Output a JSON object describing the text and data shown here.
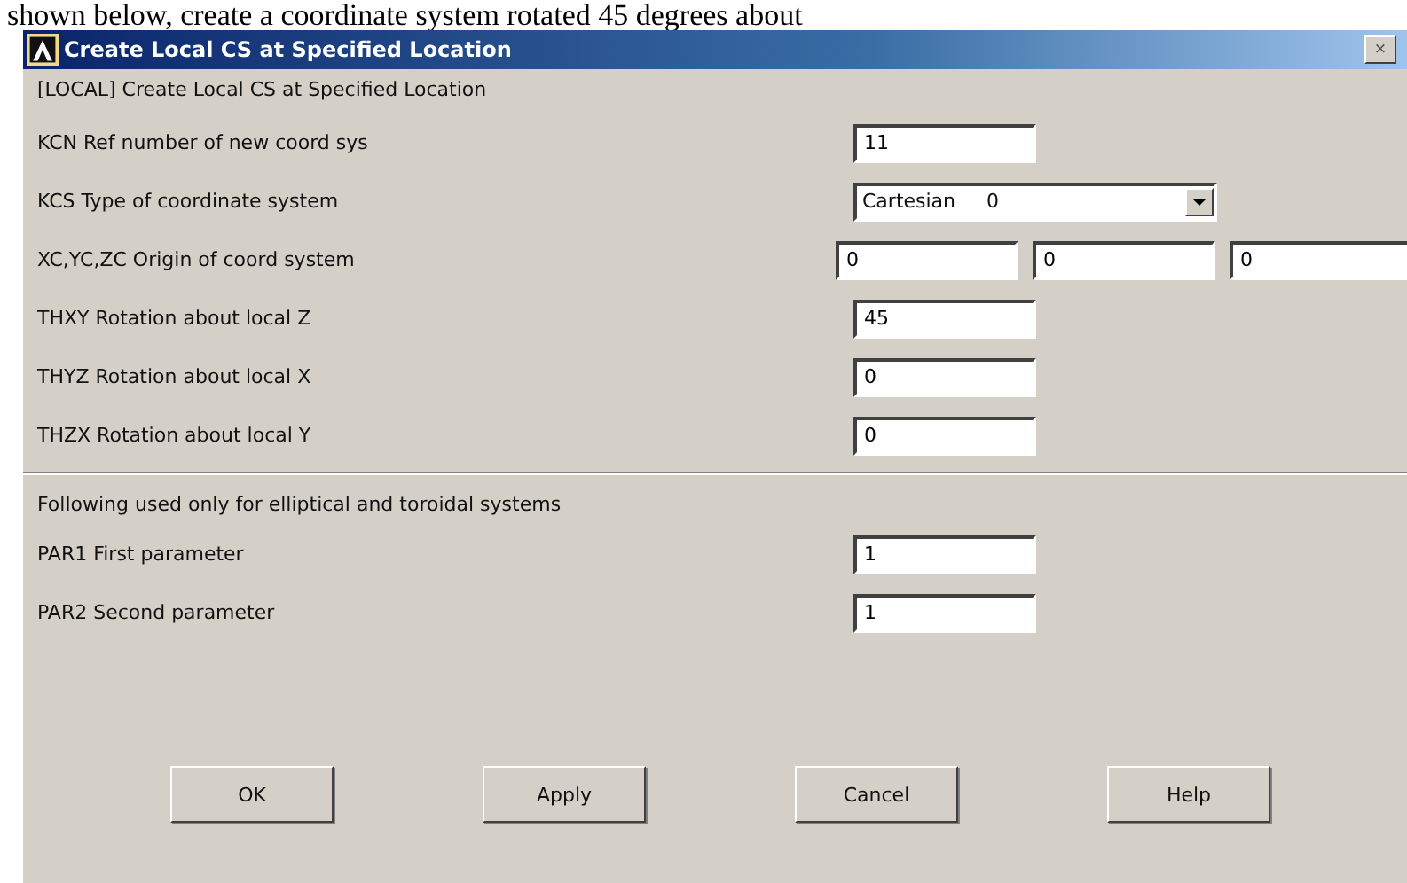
{
  "page_text": "shown below, create a coordinate system rotated 45 degrees about",
  "window": {
    "title": "Create Local CS at Specified Location",
    "close": "×"
  },
  "heading": "[LOCAL]  Create Local CS at Specified Location",
  "fields": [
    {
      "kind": "text",
      "label": "KCN  Ref number of new coord sys",
      "values": [
        "11"
      ]
    },
    {
      "kind": "dropdown",
      "label": "KCS  Type of coordinate system",
      "values": [
        "Cartesian     0"
      ]
    },
    {
      "kind": "text",
      "label": "XC,YC,ZC  Origin of coord system",
      "values": [
        "0",
        "0",
        "0"
      ]
    },
    {
      "kind": "text",
      "label": "THXY  Rotation about local Z",
      "values": [
        "45"
      ]
    },
    {
      "kind": "text",
      "label": "THYZ  Rotation about local X",
      "values": [
        "0"
      ]
    },
    {
      "kind": "text",
      "label": "THZX  Rotation about local Y",
      "values": [
        "0"
      ]
    }
  ],
  "section_note": "Following used only for elliptical and toroidal systems",
  "extra_fields": [
    {
      "kind": "text",
      "label": "PAR1  First parameter",
      "values": [
        "1"
      ]
    },
    {
      "kind": "text",
      "label": "PAR2  Second parameter",
      "values": [
        "1"
      ]
    }
  ],
  "buttons": [
    "OK",
    "Apply",
    "Cancel",
    "Help"
  ]
}
